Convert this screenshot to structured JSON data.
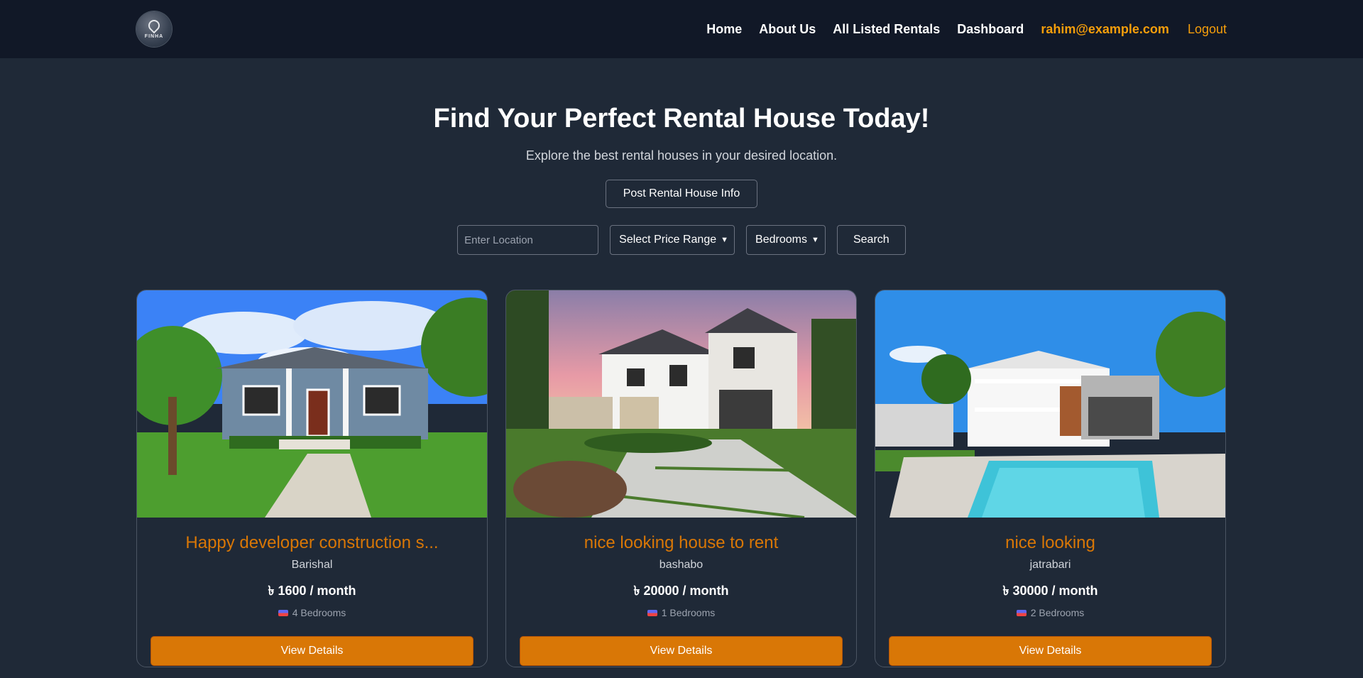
{
  "nav": {
    "logo_text": "FINHA",
    "links": [
      "Home",
      "About Us",
      "All Listed Rentals",
      "Dashboard"
    ],
    "user_email": "rahim@example.com",
    "logout_label": "Logout"
  },
  "hero": {
    "title": "Find Your Perfect Rental House Today!",
    "subtitle": "Explore the best rental houses in your desired location.",
    "post_button": "Post Rental House Info"
  },
  "search": {
    "location_placeholder": "Enter Location",
    "price_select": "Select Price Range",
    "bedrooms_select": "Bedrooms",
    "search_button": "Search"
  },
  "listings": [
    {
      "title": "Happy developer construction s...",
      "location": "Barishal",
      "price": "৳ 1600 / month",
      "bedrooms": "4 Bedrooms",
      "button": "View Details",
      "image": "bungalow-house-photo"
    },
    {
      "title": "nice looking house to rent",
      "location": "bashabo",
      "price": "৳ 20000 / month",
      "bedrooms": "1 Bedrooms",
      "button": "View Details",
      "image": "modern-farmhouse-photo"
    },
    {
      "title": "nice looking",
      "location": "jatrabari",
      "price": "৳ 30000 / month",
      "bedrooms": "2 Bedrooms",
      "button": "View Details",
      "image": "pool-house-photo"
    }
  ],
  "colors": {
    "accent": "#d97706",
    "nav_bg": "#111827",
    "page_bg": "#1f2937"
  }
}
